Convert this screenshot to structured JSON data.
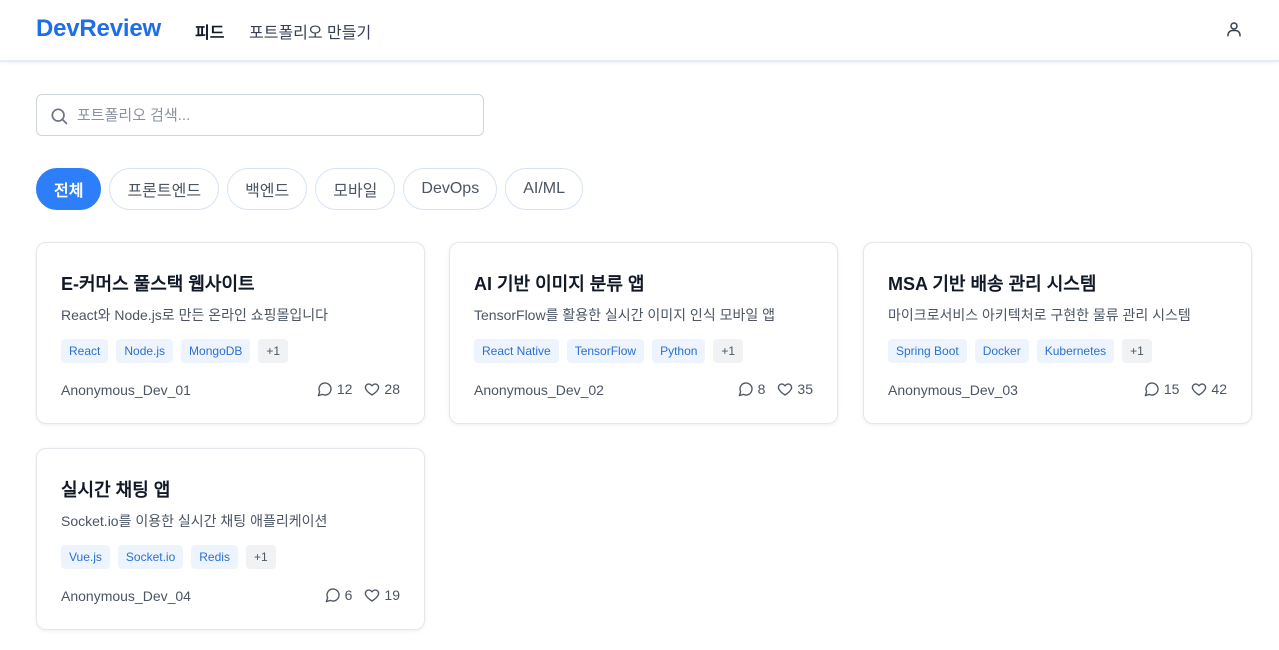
{
  "header": {
    "logo": "DevReview",
    "nav": [
      {
        "label": "피드",
        "active": true
      },
      {
        "label": "포트폴리오 만들기",
        "active": false
      }
    ],
    "user_icon": "user-icon"
  },
  "search": {
    "placeholder": "포트폴리오 검색...",
    "value": "",
    "icon": "search-icon"
  },
  "filters": [
    {
      "label": "전체",
      "active": true
    },
    {
      "label": "프론트엔드",
      "active": false
    },
    {
      "label": "백엔드",
      "active": false
    },
    {
      "label": "모바일",
      "active": false
    },
    {
      "label": "DevOps",
      "active": false
    },
    {
      "label": "AI/ML",
      "active": false
    }
  ],
  "cards": [
    {
      "title": "E-커머스 풀스택 웹사이트",
      "description": "React와 Node.js로 만든 온라인 쇼핑몰입니다",
      "tags": [
        "React",
        "Node.js",
        "MongoDB"
      ],
      "more_tags": "+1",
      "author": "Anonymous_Dev_01",
      "comments": "12",
      "likes": "28"
    },
    {
      "title": "AI 기반 이미지 분류 앱",
      "description": "TensorFlow를 활용한 실시간 이미지 인식 모바일 앱",
      "tags": [
        "React Native",
        "TensorFlow",
        "Python"
      ],
      "more_tags": "+1",
      "author": "Anonymous_Dev_02",
      "comments": "8",
      "likes": "35"
    },
    {
      "title": "MSA 기반 배송 관리 시스템",
      "description": "마이크로서비스 아키텍처로 구현한 물류 관리 시스템",
      "tags": [
        "Spring Boot",
        "Docker",
        "Kubernetes"
      ],
      "more_tags": "+1",
      "author": "Anonymous_Dev_03",
      "comments": "15",
      "likes": "42"
    },
    {
      "title": "실시간 채팅 앱",
      "description": "Socket.io를 이용한 실시간 채팅 애플리케이션",
      "tags": [
        "Vue.js",
        "Socket.io",
        "Redis"
      ],
      "more_tags": "+1",
      "author": "Anonymous_Dev_04",
      "comments": "6",
      "likes": "19"
    }
  ],
  "colors": {
    "brand": "#1d6ee8",
    "accent": "#2d7ff9",
    "tag_bg": "#eef4fd",
    "tag_text": "#2b6fd6"
  }
}
